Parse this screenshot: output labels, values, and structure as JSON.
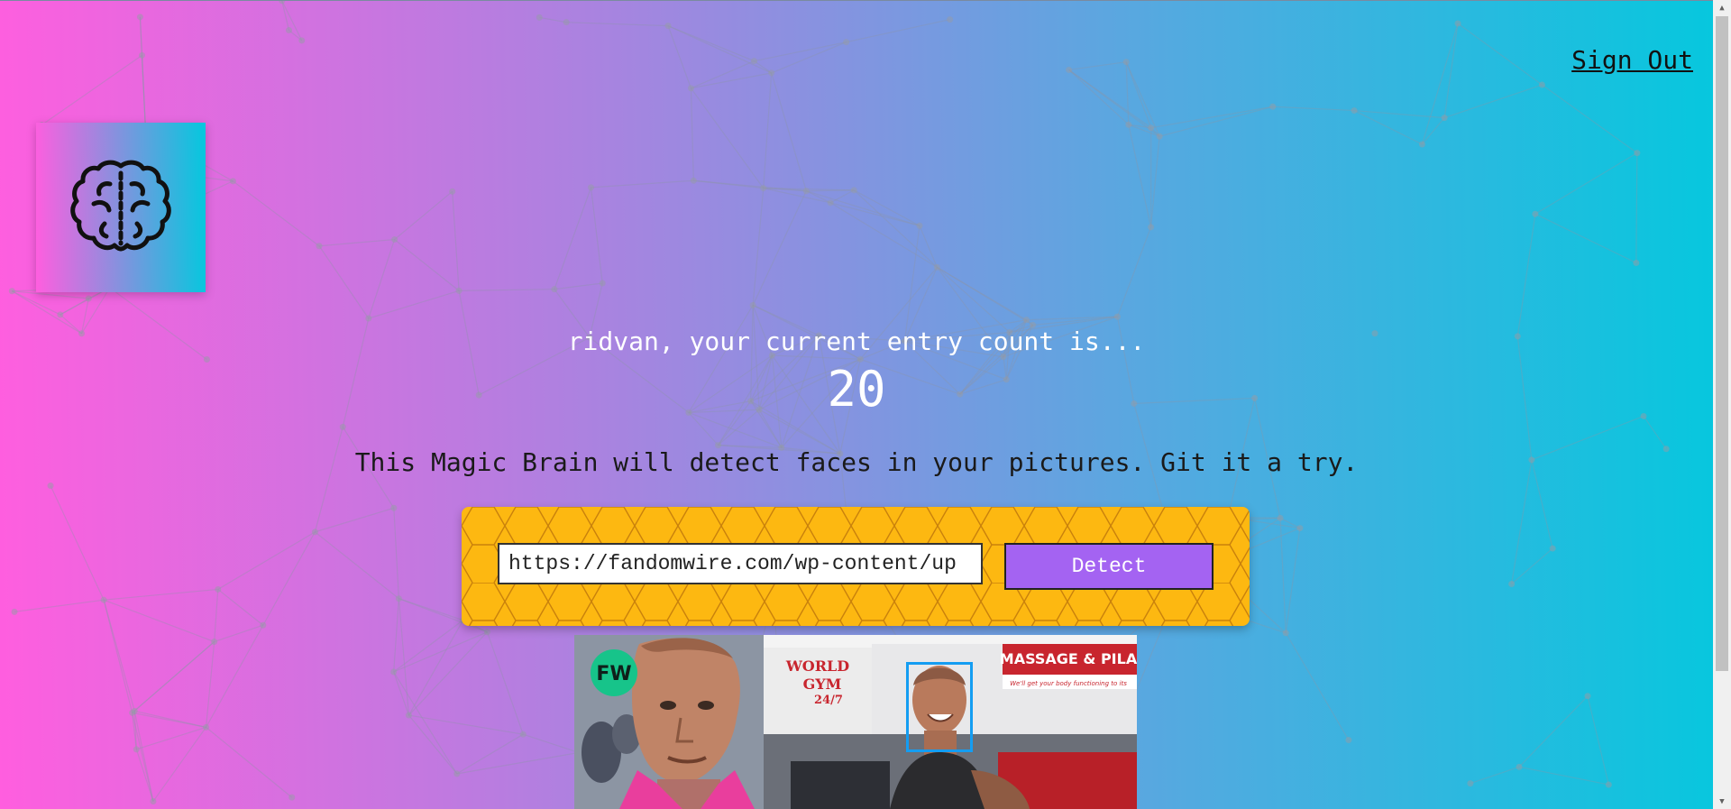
{
  "header": {
    "sign_out_label": "Sign Out"
  },
  "logo": {
    "icon": "brain-icon"
  },
  "rank": {
    "message": "ridvan, your current entry count is...",
    "count": "20"
  },
  "intro": {
    "text": "This Magic Brain will detect faces in your pictures. Git it a try."
  },
  "form": {
    "input_value": "https://fandomwire.com/wp-content/up",
    "button_label": "Detect"
  },
  "image": {
    "badge": "FW",
    "gym_sign_top": "WORLD",
    "gym_sign_bottom": "GYM",
    "gym_hours": "24/7",
    "massage_sign": "MASSAGE & PILA",
    "tagline": "We'll get your body functioning to its"
  },
  "colors": {
    "gradient_start": "#ff5edf",
    "gradient_end": "#04c8de",
    "panel": "#fdb811",
    "button": "#a463f2",
    "face_box": "#149df2"
  }
}
